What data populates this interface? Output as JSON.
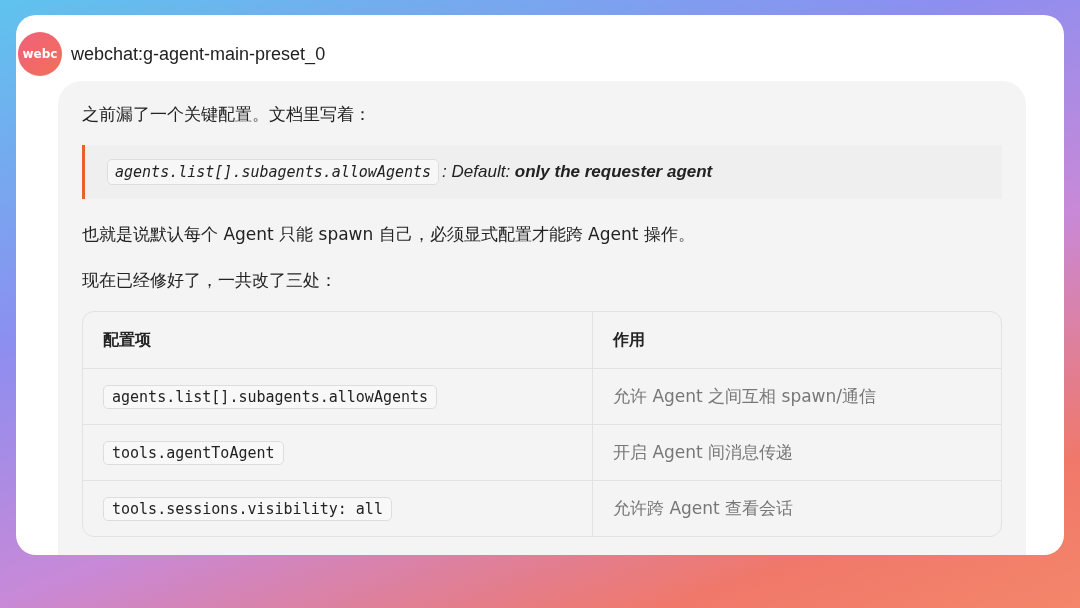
{
  "message": {
    "avatar": "webc",
    "sender": "webchat:g-agent-main-preset_0",
    "intro": "之前漏了一个关键配置。文档里写着：",
    "quote": {
      "code": "agents.list[].subagents.allowAgents",
      "text": ": Default: **only the requester agent**"
    },
    "paragraphs": [
      "也就是说默认每个 Agent 只能 spawn 自己，必须显式配置才能跨 Agent 操作。",
      "现在已经修好了，一共改了三处："
    ],
    "table": {
      "columns": [
        "配置项",
        "作用"
      ],
      "rows": [
        {
          "key": "agents.list[].subagents.allowAgents",
          "effect": "允许 Agent 之间互相 spawn/通信"
        },
        {
          "key": "tools.agentToAgent",
          "effect": "开启 Agent 间消息传递"
        },
        {
          "key": "tools.sessions.visibility: all",
          "effect": "允许跨 Agent 查看会话"
        }
      ]
    }
  }
}
